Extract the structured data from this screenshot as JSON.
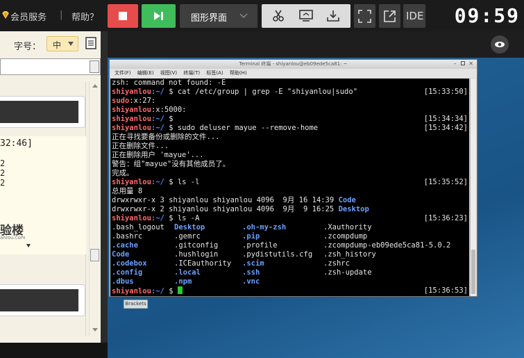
{
  "topbar": {
    "vip_label": "会员服务",
    "separator": "|",
    "help_label": "帮助？",
    "gui_label": "图形界面",
    "ide_label": "IDE",
    "clock": "09:59"
  },
  "left_panel": {
    "font_size_label": "字号：",
    "font_size_value": "中",
    "fragment_time": "32:46]",
    "fragment_lines": [
      "2",
      "2",
      "2"
    ],
    "logo_text": "验楼",
    "logo_url": "anlou.com"
  },
  "terminal": {
    "title": "Terminal 终端 - shiyanlou@eb09ede5ca81: ~",
    "menu": [
      "文件(F)",
      "编辑(E)",
      "视图(V)",
      "终端(T)",
      "标签(A)",
      "帮助(H)"
    ],
    "lines": [
      {
        "text": "zsh: command not found: -E"
      },
      {
        "user": "shiyanlou",
        "path": ":~/",
        "cmd": " $ cat /etc/group | grep -E \"shiyanlou|sudo\"",
        "time": "[15:33:50]"
      },
      {
        "red": "sudo",
        "text": ":x:27:"
      },
      {
        "red": "shiyanlou",
        "text": ":x:5000:"
      },
      {
        "user": "shiyanlou",
        "path": ":~/",
        "cmd": " $",
        "time": "[15:34:34]"
      },
      {
        "user": "shiyanlou",
        "path": ":~/",
        "cmd": " $ sudo deluser mayue --remove-home",
        "time": "[15:34:42]"
      },
      {
        "text": "正在寻找要备份或删除的文件..."
      },
      {
        "text": "正在删除文件..."
      },
      {
        "text": "正在删除用户 'mayue'..."
      },
      {
        "text": "警告：组\"mayue\"没有其他成员了。"
      },
      {
        "text": "完成。"
      },
      {
        "user": "shiyanlou",
        "path": ":~/",
        "cmd": " $ ls -l",
        "time": "[15:35:52]"
      },
      {
        "text": "总用量 8"
      },
      {
        "text": "drwxrwxr-x 3 shiyanlou shiyanlou 4096  9月 16 14:39 ",
        "blue": "Code"
      },
      {
        "text": "drwxrwxr-x 2 shiyanlou shiyanlou 4096  9月  9 16:25 ",
        "blue": "Desktop"
      },
      {
        "user": "shiyanlou",
        "path": ":~/",
        "cmd": " $ ls -A",
        "time": "[15:36:23]"
      }
    ],
    "ls_rows": [
      [
        {
          "t": ".bash_logout"
        },
        {
          "t": "Desktop",
          "b": true
        },
        {
          "t": ".oh-my-zsh",
          "b": true
        },
        {
          "t": ".Xauthority"
        }
      ],
      [
        {
          "t": ".bashrc"
        },
        {
          "t": ".gemrc"
        },
        {
          "t": ".pip",
          "b": true
        },
        {
          "t": ".zcompdump"
        }
      ],
      [
        {
          "t": ".cache",
          "b": true
        },
        {
          "t": ".gitconfig"
        },
        {
          "t": ".profile"
        },
        {
          "t": ".zcompdump-eb09ede5ca81-5.0.2"
        }
      ],
      [
        {
          "t": "Code",
          "b": true
        },
        {
          "t": ".hushlogin"
        },
        {
          "t": ".pydistutils.cfg"
        },
        {
          "t": ".zsh_history"
        }
      ],
      [
        {
          "t": ".codebox",
          "b": true
        },
        {
          "t": ".ICEauthority"
        },
        {
          "t": ".scim",
          "b": true
        },
        {
          "t": ".zshrc"
        }
      ],
      [
        {
          "t": ".config",
          "b": true
        },
        {
          "t": ".local",
          "b": true
        },
        {
          "t": ".ssh",
          "b": true
        },
        {
          "t": ".zsh-update"
        }
      ],
      [
        {
          "t": ".dbus",
          "b": true
        },
        {
          "t": ".npm",
          "b": true
        },
        {
          "t": ".vnc",
          "b": true
        },
        {
          "t": ""
        }
      ]
    ],
    "prompt": {
      "user": "shiyanlou",
      "path": ":~/",
      "cmd": " $ ",
      "time": "[15:36:53]"
    }
  },
  "desktop": {
    "brackets_label": "Brackets"
  }
}
